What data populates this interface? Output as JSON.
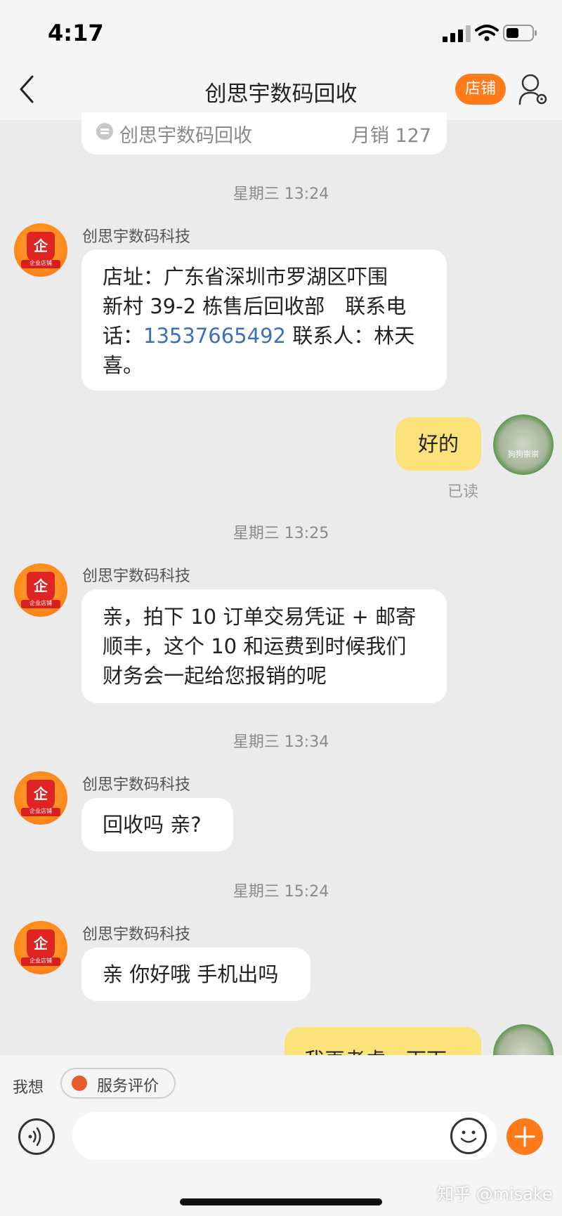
{
  "status": {
    "time": "4:17"
  },
  "nav": {
    "title": "创思宇数码回收",
    "shop_label": "店铺"
  },
  "top_card": {
    "shop_name": "创思宇数码回收",
    "monthly_sales": "月销 127"
  },
  "chat": [
    {
      "timestamp": "星期三 13:24",
      "sender": "创思宇数码科技",
      "lines": [
        "店址：广东省深圳市罗湖区吓围",
        "新村 39-2 栋售后回收部　联系电"
      ],
      "line3_prefix": "话：",
      "phone": "13537665492",
      "line3_suffix": " 联系人：林天",
      "line4": "喜。"
    },
    {
      "mine": "好的",
      "read_status": "已读"
    },
    {
      "timestamp": "星期三 13:25",
      "sender": "创思宇数码科技",
      "lines": [
        "亲，拍下 10 订单交易凭证 + 邮寄",
        "顺丰，这个 10 和运费到时候我们",
        "财务会一起给您报销的呢"
      ]
    },
    {
      "timestamp": "星期三 13:34",
      "sender": "创思宇数码科技",
      "text": "回收吗 亲?"
    },
    {
      "timestamp": "星期三 15:24",
      "sender": "创思宇数码科技",
      "text": "亲 你好哦 手机出吗"
    },
    {
      "mine_partial": "我再考虑一下下"
    }
  ],
  "seller_avatar": {
    "badge_text": "企",
    "ribbon_text": "企业店铺"
  },
  "user_avatar": {
    "caption": "狗狗崇崇"
  },
  "bottom": {
    "wish_label": "我想",
    "service_label": "服务评价"
  },
  "watermark": "知乎 @misake",
  "colors": {
    "accent": "#ff7a1a",
    "my_bubble": "#fbe27b",
    "link": "#3a71b8"
  }
}
